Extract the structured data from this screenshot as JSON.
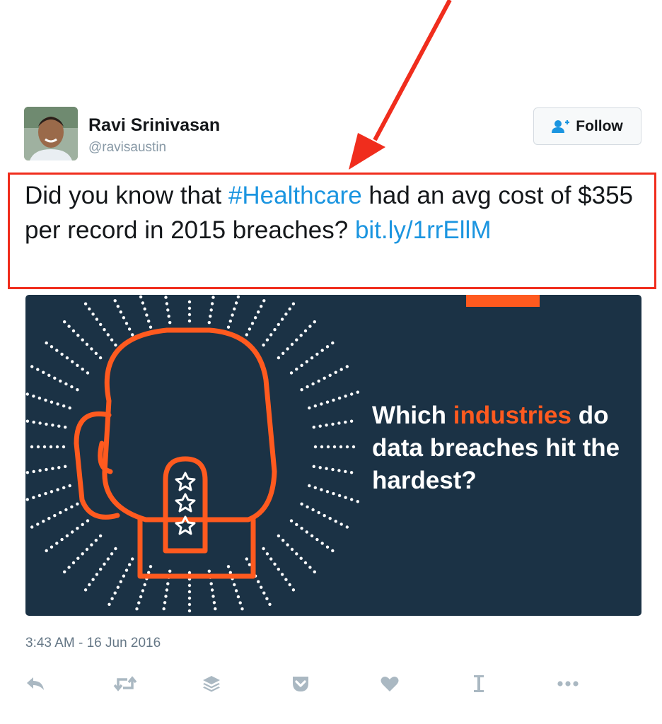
{
  "tweet": {
    "author_name": "Ravi Srinivasan",
    "author_handle": "@ravisaustin",
    "follow_label": "Follow",
    "text_before": "Did you know that ",
    "hashtag": "#Healthcare",
    "text_after": " had an avg cost of $355 per record in 2015 breaches? ",
    "link": "bit.ly/1rrEllM",
    "timestamp": "3:43 AM - 16 Jun 2016"
  },
  "media": {
    "headline_before": "Which ",
    "headline_accent": "industries",
    "headline_after": " do data breaches hit the hardest?",
    "background_color": "#1b3245",
    "accent_color": "#ff5a1f"
  },
  "actions": [
    {
      "name": "reply-icon"
    },
    {
      "name": "retweet-icon"
    },
    {
      "name": "buffer-icon"
    },
    {
      "name": "pocket-icon"
    },
    {
      "name": "like-icon"
    },
    {
      "name": "instapaper-icon"
    },
    {
      "name": "more-icon"
    }
  ],
  "colors": {
    "link": "#1b95e0",
    "annotation": "#f02d1d",
    "muted": "#8899a6",
    "action_icon": "#aab8c2"
  }
}
